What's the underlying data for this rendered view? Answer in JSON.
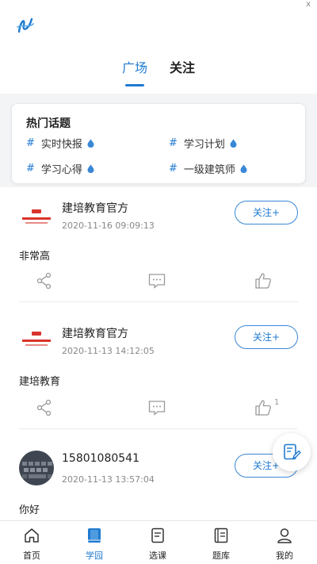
{
  "status": {
    "close_glyph": "x"
  },
  "tabs": [
    {
      "label": "广场",
      "active": true
    },
    {
      "label": "关注",
      "active": false
    }
  ],
  "hot_topics": {
    "title": "热门话题",
    "hash_symbol": "#",
    "items": [
      {
        "label": "实时快报"
      },
      {
        "label": "学习计划"
      },
      {
        "label": "学习心得"
      },
      {
        "label": "一级建筑师"
      }
    ]
  },
  "posts": [
    {
      "author": "建培教育官方",
      "time": "2020-11-16 09:09:13",
      "content": "非常高",
      "follow_label": "关注+",
      "like_count": ""
    },
    {
      "author": "建培教育官方",
      "time": "2020-11-13 14:12:05",
      "content": "建培教育",
      "follow_label": "关注+",
      "like_count": "1"
    },
    {
      "author": "15801080541",
      "time": "2020-11-13 13:57:04",
      "content": "你好",
      "follow_label": "关注+",
      "like_count": ""
    }
  ],
  "bottom_nav": [
    {
      "label": "首页",
      "icon": "home-icon",
      "active": false
    },
    {
      "label": "学园",
      "icon": "book-icon",
      "active": true
    },
    {
      "label": "选课",
      "icon": "course-icon",
      "active": false
    },
    {
      "label": "题库",
      "icon": "question-bank-icon",
      "active": false
    },
    {
      "label": "我的",
      "icon": "user-icon",
      "active": false
    }
  ],
  "colors": {
    "accent": "#1f7ad0",
    "background": "#f3f4f6"
  }
}
